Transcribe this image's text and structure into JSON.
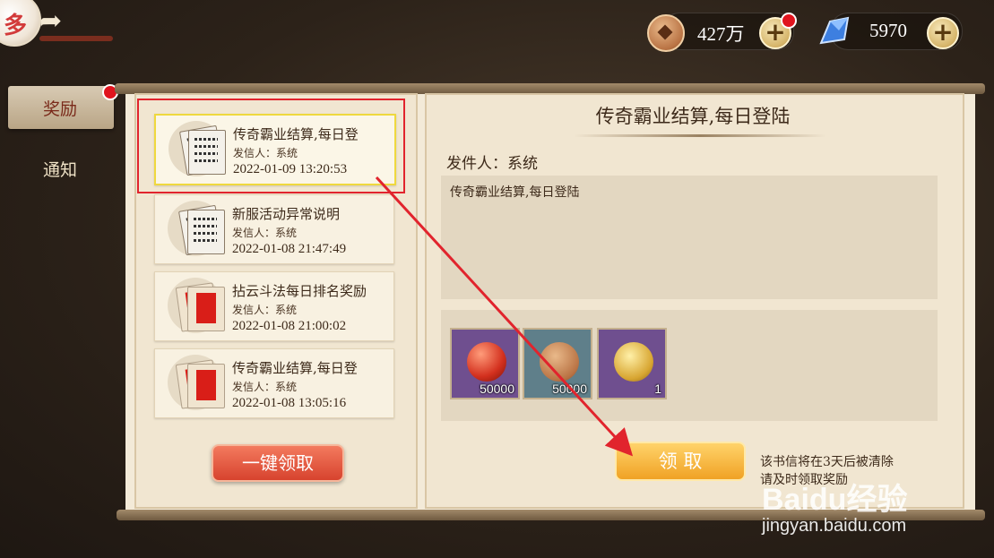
{
  "currency": {
    "coins": {
      "icon": "coin-icon",
      "value": "427万"
    },
    "gems": {
      "icon": "crystal-icon",
      "value": "5970"
    },
    "plus_symbol": "+"
  },
  "back_button": {
    "glyph": "多"
  },
  "nav": [
    {
      "label": "奖励",
      "active": true,
      "badge": true
    },
    {
      "label": "通知",
      "active": false,
      "badge": false
    }
  ],
  "mail_list": [
    {
      "title": "传奇霸业结算,每日登",
      "sender": "发信人：系统",
      "time": "2022-01-09 13:20:53",
      "icon": "letter-icon",
      "selected": true
    },
    {
      "title": "新服活动异常说明",
      "sender": "发信人：系统",
      "time": "2022-01-08 21:47:49",
      "icon": "letter-icon",
      "selected": false
    },
    {
      "title": "拈云斗法每日排名奖励",
      "sender": "发信人：系统",
      "time": "2022-01-08 21:00:02",
      "icon": "red-envelope-icon",
      "selected": false
    },
    {
      "title": "传奇霸业结算,每日登",
      "sender": "发信人：系统",
      "time": "2022-01-08 13:05:16",
      "icon": "red-envelope-icon",
      "selected": false
    }
  ],
  "claim_all_label": "一键领取",
  "detail": {
    "title": "传奇霸业结算,每日登陆",
    "sender": "发件人：系统",
    "body": "传奇霸业结算,每日登陆",
    "rewards": [
      {
        "icon": "red-orb-icon",
        "count": "50000",
        "bg": "#6f4f8f"
      },
      {
        "icon": "copper-coin-icon",
        "count": "50000",
        "bg": "#5f7f8a"
      },
      {
        "icon": "gold-medal-icon",
        "count": "1",
        "bg": "#6f4f8f"
      }
    ],
    "claim_label": "领 取",
    "expire_note_1": "该书信将在3天后被清除",
    "expire_note_2": "请及时领取奖励"
  },
  "watermark": {
    "logo": "Baidu经验",
    "url": "jingyan.baidu.com"
  },
  "colors": {
    "highlight": "#e1242d",
    "arrow": "#e1242d",
    "badge": "#e0141e"
  }
}
